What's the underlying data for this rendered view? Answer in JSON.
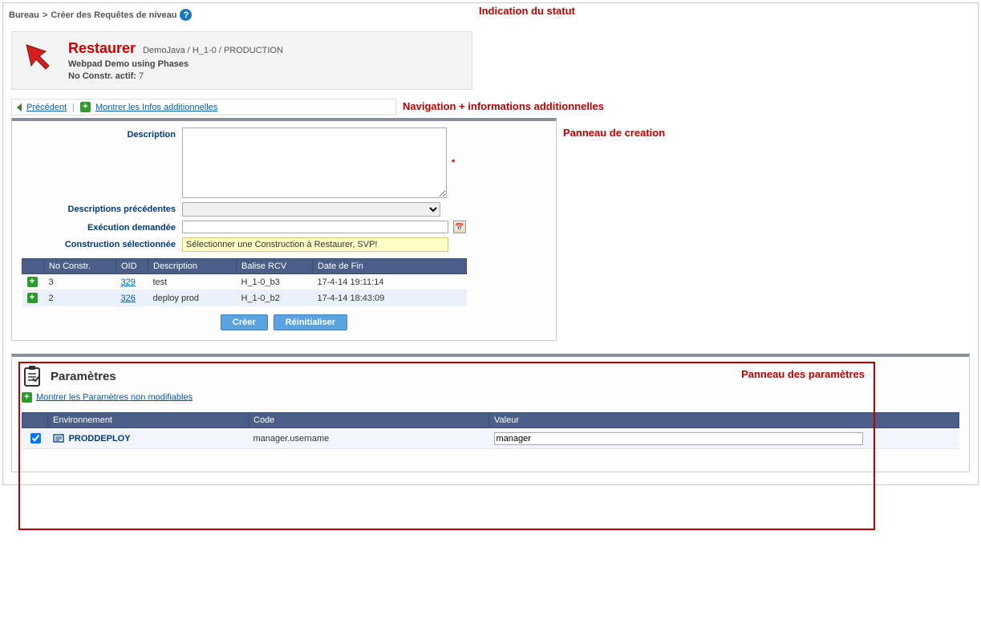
{
  "breadcrumb": {
    "part1": "Bureau",
    "sep": ">",
    "part2": "Créer des Requêtes de niveau"
  },
  "annotations": {
    "status": "Indication du statut",
    "nav": "Navigation + informations additionnelles",
    "creation": "Panneau de creation",
    "params": "Panneau des paramètres"
  },
  "status": {
    "title": "Restaurer",
    "path": "DemoJava / H_1-0 / PRODUCTION",
    "subtitle": "Webpad Demo using Phases",
    "constr_label": "No Constr. actif:",
    "constr_value": "7"
  },
  "nav": {
    "back": "Précédent",
    "show_info": "Montrer les Infos additionnelles"
  },
  "form": {
    "description_label": "Description",
    "description_value": "",
    "prev_desc_label": "Descriptions précédentes",
    "exec_label": "Exécution demandée",
    "exec_value": "",
    "sel_constr_label": "Construction sélectionnée",
    "sel_constr_warning": "Sélectionner une Construction à Restaurer, SVP!"
  },
  "table": {
    "headers": [
      "",
      "No Constr.",
      "OID",
      "Description",
      "Balise RCV",
      "Date de Fin"
    ],
    "rows": [
      {
        "no": "3",
        "oid": "329",
        "desc": "test",
        "tag": "H_1-0_b3",
        "end": "17-4-14 19:11:14"
      },
      {
        "no": "2",
        "oid": "326",
        "desc": "deploy prod",
        "tag": "H_1-0_b2",
        "end": "17-4-14 18:43:09"
      }
    ]
  },
  "buttons": {
    "create": "Créer",
    "reset": "Réinitialiser"
  },
  "params": {
    "title": "Paramètres",
    "show_ro": "Montrer les Paramètres non modifiables",
    "headers": [
      "",
      "Environnement",
      "Code",
      "Valeur"
    ],
    "rows": [
      {
        "env": "PRODDEPLOY",
        "code": "manager.username",
        "value": "manager",
        "checked": true
      }
    ]
  }
}
